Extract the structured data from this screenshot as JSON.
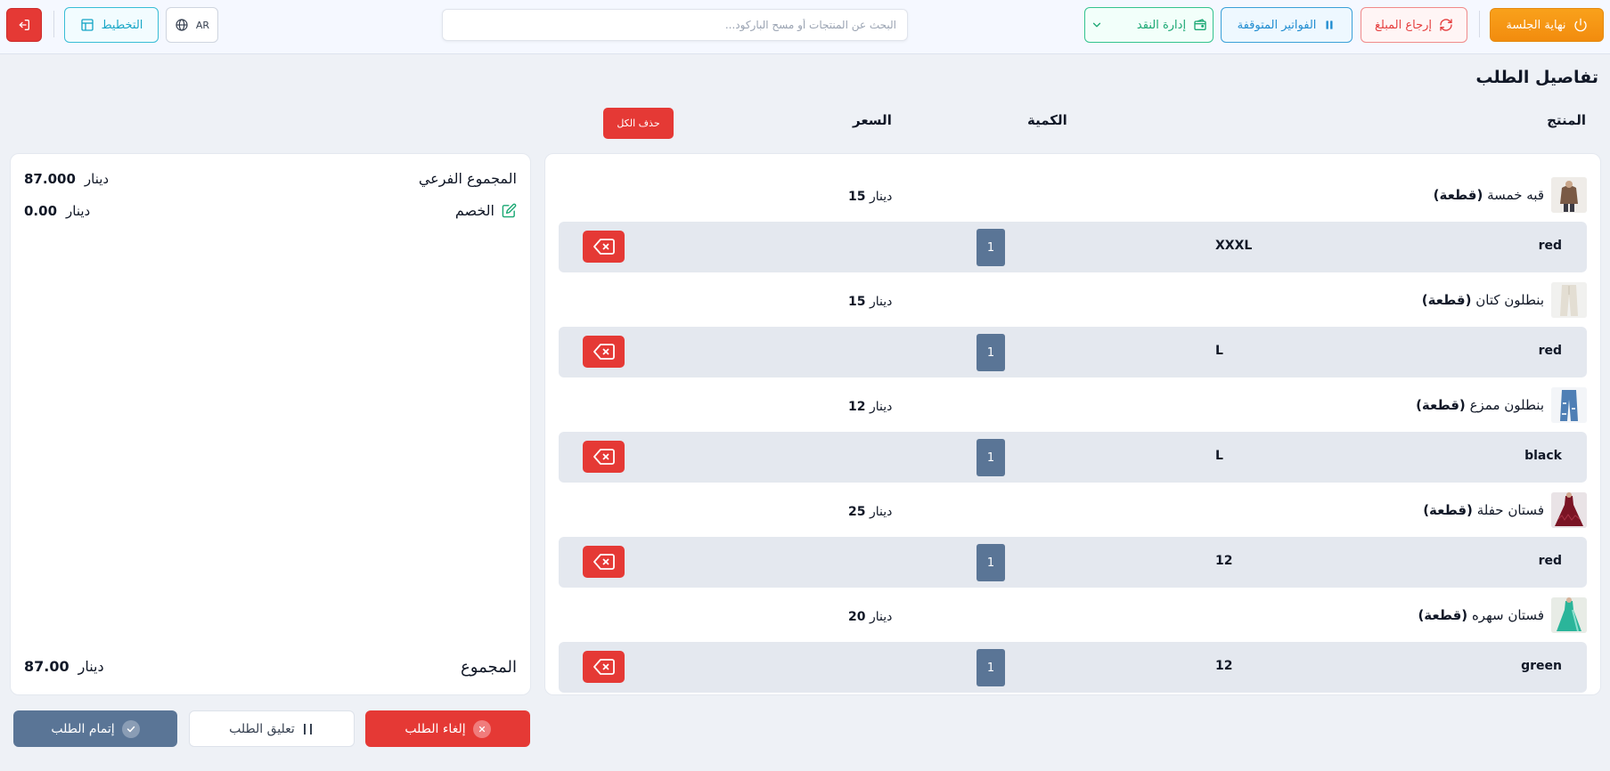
{
  "toolbar": {
    "end_session_label": "نهاية الجلسة",
    "refund_label": "إرجاع المبلغ",
    "held_invoices_label": "الفواتير المتوقفة",
    "cash_management_label": "إدارة النقد",
    "search_placeholder": "البحث عن المنتجات أو مسح الباركود...",
    "language_label": "AR",
    "layout_label": "التخطيط"
  },
  "order": {
    "title": "تفاصيل الطلب",
    "columns": {
      "product": "المنتج",
      "quantity": "الكمية",
      "price": "السعر"
    },
    "delete_all_label": "حذف الكل",
    "unit_label": "(قطعة)",
    "currency": "دينار",
    "items": [
      {
        "name": "قبه خمسة",
        "price": "15",
        "color": "red",
        "size": "XXXL",
        "qty": "1"
      },
      {
        "name": "بنطلون كتان",
        "price": "15",
        "color": "red",
        "size": "L",
        "qty": "1"
      },
      {
        "name": "بنطلون ممزع",
        "price": "12",
        "color": "black",
        "size": "L",
        "qty": "1"
      },
      {
        "name": "فستان حفلة",
        "price": "25",
        "color": "red",
        "size": "12",
        "qty": "1"
      },
      {
        "name": "فستان سهره",
        "price": "20",
        "color": "green",
        "size": "12",
        "qty": "1"
      }
    ]
  },
  "totals": {
    "subtotal_label": "المجموع الفرعي",
    "subtotal_value": "87.000",
    "discount_label": "الخصم",
    "discount_value": "0.00",
    "total_label": "المجموع",
    "total_value": "87.00",
    "currency": "دينار"
  },
  "actions": {
    "complete_label": "إتمام الطلب",
    "hold_label": "تعليق الطلب",
    "cancel_label": "إلغاء الطلب"
  },
  "colors": {
    "accent_orange": "#f59e0b",
    "danger_red": "#e53935",
    "info_blue": "#1f8cd0",
    "success_green": "#1aa873",
    "slate": "#5a7596"
  },
  "icons": {
    "end_session": "power-icon",
    "refund": "refresh-icon",
    "held": "pause-icon",
    "cash": "wallet-icon",
    "cash_toggle": "chevron-down-icon",
    "language": "globe-icon",
    "layout": "layout-icon",
    "logout": "logout-icon",
    "delete": "backspace-icon",
    "discount_edit": "edit-icon",
    "complete": "check-icon",
    "hold": "pause-icon",
    "cancel": "close-icon"
  }
}
